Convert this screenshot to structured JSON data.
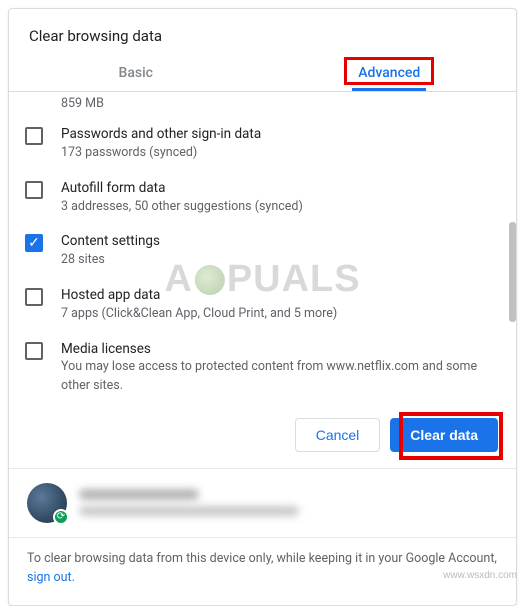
{
  "dialog": {
    "title": "Clear browsing data"
  },
  "tabs": {
    "basic": "Basic",
    "advanced": "Advanced"
  },
  "truncated_item_sub": "859 MB",
  "items": [
    {
      "title": "Passwords and other sign-in data",
      "sub": "173 passwords (synced)",
      "checked": false
    },
    {
      "title": "Autofill form data",
      "sub": "3 addresses, 50 other suggestions (synced)",
      "checked": false
    },
    {
      "title": "Content settings",
      "sub": "28 sites",
      "checked": true
    },
    {
      "title": "Hosted app data",
      "sub": "7 apps (Click&Clean App, Cloud Print, and 5 more)",
      "checked": false
    },
    {
      "title": "Media licenses",
      "sub": "You may lose access to protected content from www.netflix.com and some other sites.",
      "checked": false
    }
  ],
  "buttons": {
    "cancel": "Cancel",
    "clear": "Clear data"
  },
  "footer": {
    "text_before": "To clear browsing data from this device only, while keeping it in your Google Account, ",
    "link": "sign out",
    "text_after": "."
  },
  "watermark": {
    "center_before": "A",
    "center_after": "PUALS",
    "source": "www.wsxdn.com"
  }
}
